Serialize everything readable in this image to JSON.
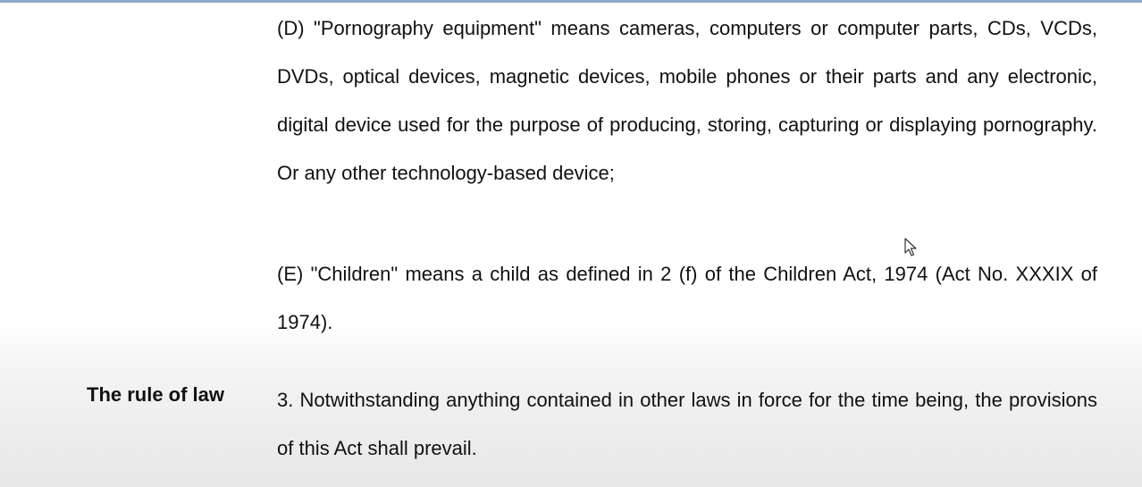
{
  "document": {
    "definitions": [
      {
        "id": "D",
        "text": "(D) \"Pornography equipment\" means cameras, computers or computer parts, CDs, VCDs, DVDs, optical devices, magnetic devices, mobile phones or their parts and any electronic, digital device used for the purpose of producing, storing, capturing or displaying pornography. Or any other technology-based device;"
      },
      {
        "id": "E",
        "text": "(E) \"Children\" means a child as defined in 2 (f) of the Children Act, 1974 (Act No. XXXIX of 1974)."
      }
    ],
    "section": {
      "margin_heading": "The rule of law",
      "text": "3. Notwithstanding anything contained in other laws in force for the time being, the provisions of this Act shall prevail."
    }
  },
  "icons": {
    "cursor": "mouse-pointer-icon"
  },
  "colors": {
    "top_rule": "#8ea9c9",
    "text": "#111111"
  }
}
